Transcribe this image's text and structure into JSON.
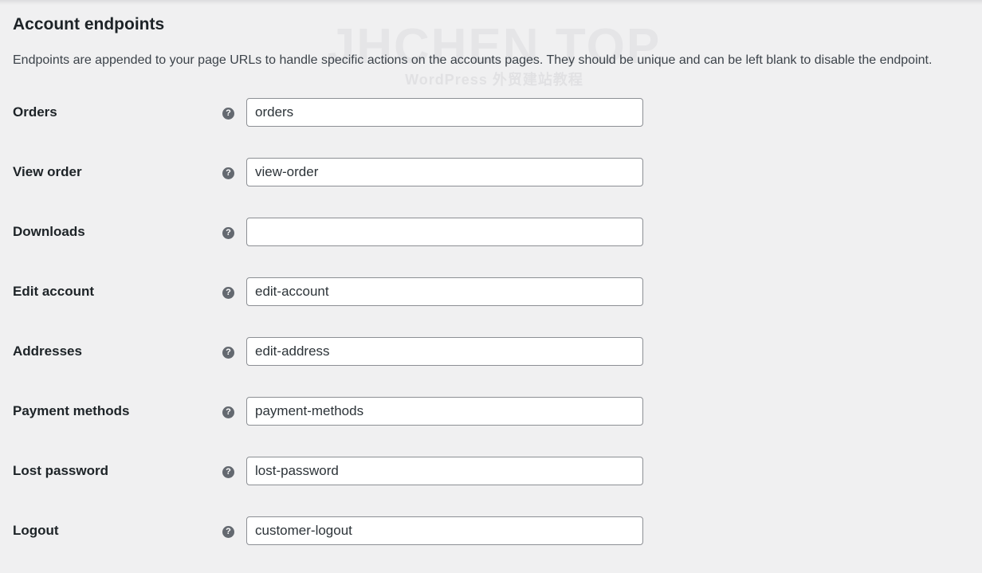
{
  "section": {
    "title": "Account endpoints",
    "description": "Endpoints are appended to your page URLs to handle specific actions on the accounts pages. They should be unique and can be left blank to disable the endpoint."
  },
  "watermark": {
    "main": "JHCHEN TOP",
    "sub": "WordPress 外贸建站教程"
  },
  "fields": [
    {
      "label": "Orders",
      "value": "orders",
      "help_icon": "question-circle-icon"
    },
    {
      "label": "View order",
      "value": "view-order",
      "help_icon": "question-circle-icon"
    },
    {
      "label": "Downloads",
      "value": "",
      "help_icon": "question-circle-icon"
    },
    {
      "label": "Edit account",
      "value": "edit-account",
      "help_icon": "question-circle-icon"
    },
    {
      "label": "Addresses",
      "value": "edit-address",
      "help_icon": "question-circle-icon"
    },
    {
      "label": "Payment methods",
      "value": "payment-methods",
      "help_icon": "question-circle-icon"
    },
    {
      "label": "Lost password",
      "value": "lost-password",
      "help_icon": "question-circle-icon"
    },
    {
      "label": "Logout",
      "value": "customer-logout",
      "help_icon": "question-circle-icon"
    }
  ],
  "help_glyph": "?",
  "colors": {
    "background": "#f0f0f1",
    "text": "#1d2327",
    "input_border": "#8c8f94",
    "help_icon": "#646970"
  }
}
